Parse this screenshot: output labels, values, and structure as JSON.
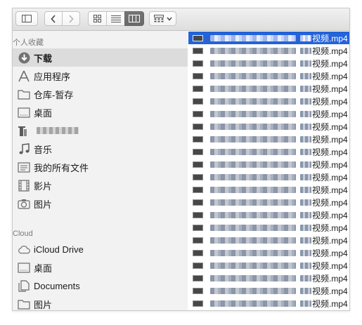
{
  "sidebar": {
    "favorites_header": "个人收藏",
    "favorites": [
      {
        "label": "下载",
        "icon": "download-icon",
        "selected": true
      },
      {
        "label": "应用程序",
        "icon": "applications-icon"
      },
      {
        "label": "仓库-暂存",
        "icon": "folder-icon"
      },
      {
        "label": "桌面",
        "icon": "desktop-icon"
      },
      {
        "label": "",
        "icon": "user-home-icon",
        "redacted": true
      },
      {
        "label": "音乐",
        "icon": "music-icon"
      },
      {
        "label": "我的所有文件",
        "icon": "all-files-icon"
      },
      {
        "label": "影片",
        "icon": "movies-icon"
      },
      {
        "label": "图片",
        "icon": "pictures-icon"
      }
    ],
    "cloud_header": "Cloud",
    "cloud": [
      {
        "label": "iCloud Drive",
        "icon": "icloud-icon"
      },
      {
        "label": "桌面",
        "icon": "desktop-icon"
      },
      {
        "label": "Documents",
        "icon": "documents-icon"
      },
      {
        "label": "图片",
        "icon": "folder-icon"
      }
    ]
  },
  "files": {
    "suffix": "视频.mp4",
    "count": 22,
    "selected_index": 0
  }
}
